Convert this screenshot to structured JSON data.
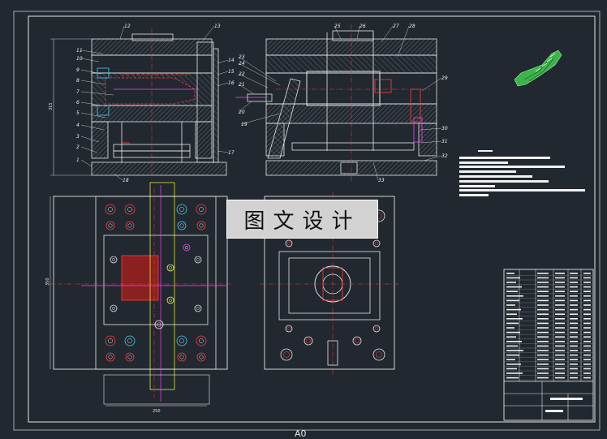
{
  "sheet_label": "A0",
  "watermark": "图文设计",
  "balloons": {
    "front": [
      "1",
      "2",
      "3",
      "4",
      "5",
      "6",
      "7",
      "8",
      "9",
      "10",
      "11",
      "12",
      "13",
      "14",
      "15",
      "16",
      "17",
      "18"
    ],
    "side": [
      "19",
      "20",
      "21",
      "22",
      "23",
      "24",
      "25",
      "26",
      "27",
      "28",
      "29",
      "30",
      "31",
      "32",
      "33"
    ]
  },
  "dimensions": {
    "front_height": "315",
    "plan_height": "350",
    "plan_width": "250"
  },
  "colors": {
    "background": "#212830",
    "line": "#e6e6e6",
    "red": "#ff3c3c",
    "magenta": "#ff3cff",
    "yellow": "#ffff3c",
    "cyan": "#3cd2ff",
    "green": "#3cd23c"
  },
  "icons": [
    "molded-part-icon"
  ]
}
